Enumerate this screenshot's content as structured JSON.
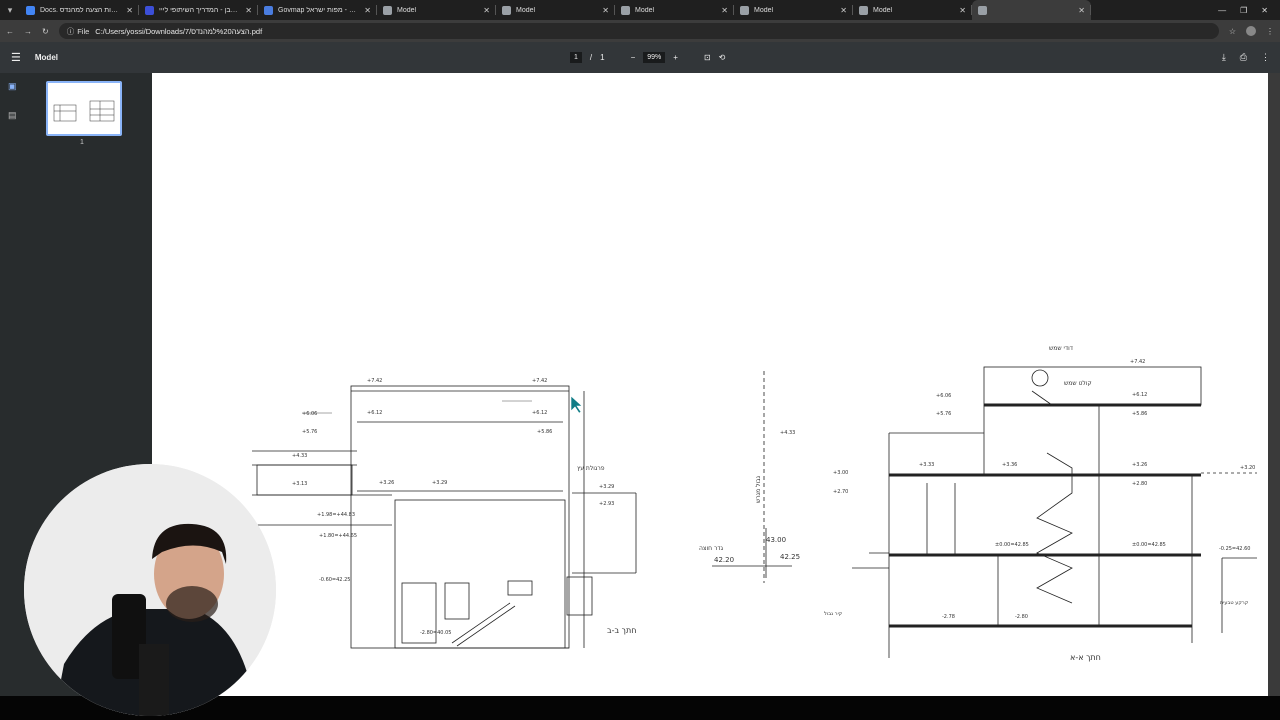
{
  "tabs": [
    {
      "title": "Docs. מהל הגשות הצעה למהנדס",
      "color": "#4285f4"
    },
    {
      "title": "עמוד עבן - המדריך השיתופי לייי",
      "color": "#3c4fd8"
    },
    {
      "title": "Govmap קווי גובה - מפות ישראל",
      "color": "#4a7de0"
    },
    {
      "title": "Model",
      "color": "#9aa0a6"
    },
    {
      "title": "Model",
      "color": "#9aa0a6"
    },
    {
      "title": "Model",
      "color": "#9aa0a6"
    },
    {
      "title": "Model",
      "color": "#9aa0a6"
    },
    {
      "title": "Model",
      "color": "#9aa0a6"
    },
    {
      "title": "",
      "color": "#9aa0a6"
    }
  ],
  "address": {
    "file_label": "File",
    "url": "C:/Users/yossi/Downloads/7/הצעה%20למהנדס.pdf"
  },
  "pdf": {
    "title": "Model",
    "page_current": "1",
    "page_sep": "/",
    "page_total": "1",
    "zoom": "99%"
  },
  "thumbnail": {
    "page_number": "1"
  },
  "drawing": {
    "section_b_title": "חתך ב-ב",
    "section_a_title": "חתך א-א",
    "levels_b": [
      "+7.42",
      "+7.42",
      "+6.06",
      "+6.12",
      "+6.12",
      "+5.86",
      "+5.76",
      "+4.33",
      "+3.26",
      "+3.29",
      "+3.29",
      "+3.13",
      "+2.93",
      "+1.98=+44.83",
      "+1.80=+44.65",
      "-0.60=42.25",
      "-2.80=40.05"
    ],
    "levels_a": [
      "+7.42",
      "+6.12",
      "+6.06",
      "+5.86",
      "+5.76",
      "+4.33",
      "+3.26",
      "+3.33",
      "+3.36",
      "+3.00",
      "+2.70",
      "+3.20",
      "+2.80",
      "±0.00=42.85",
      "±0.00=42.85",
      "-0.25=42.60",
      "-2.78",
      "-2.80"
    ],
    "heights": [
      "43.00",
      "42.25",
      "42.20"
    ],
    "labels": {
      "hood": "דודי שמש",
      "solar": "קולט שמש",
      "boundary": "גבול מגרש",
      "fence": "גדר חוצה",
      "pergola": "פרגולת עץ",
      "neighbor": "קיר גבול",
      "natural": "קרקע טבעית"
    }
  }
}
